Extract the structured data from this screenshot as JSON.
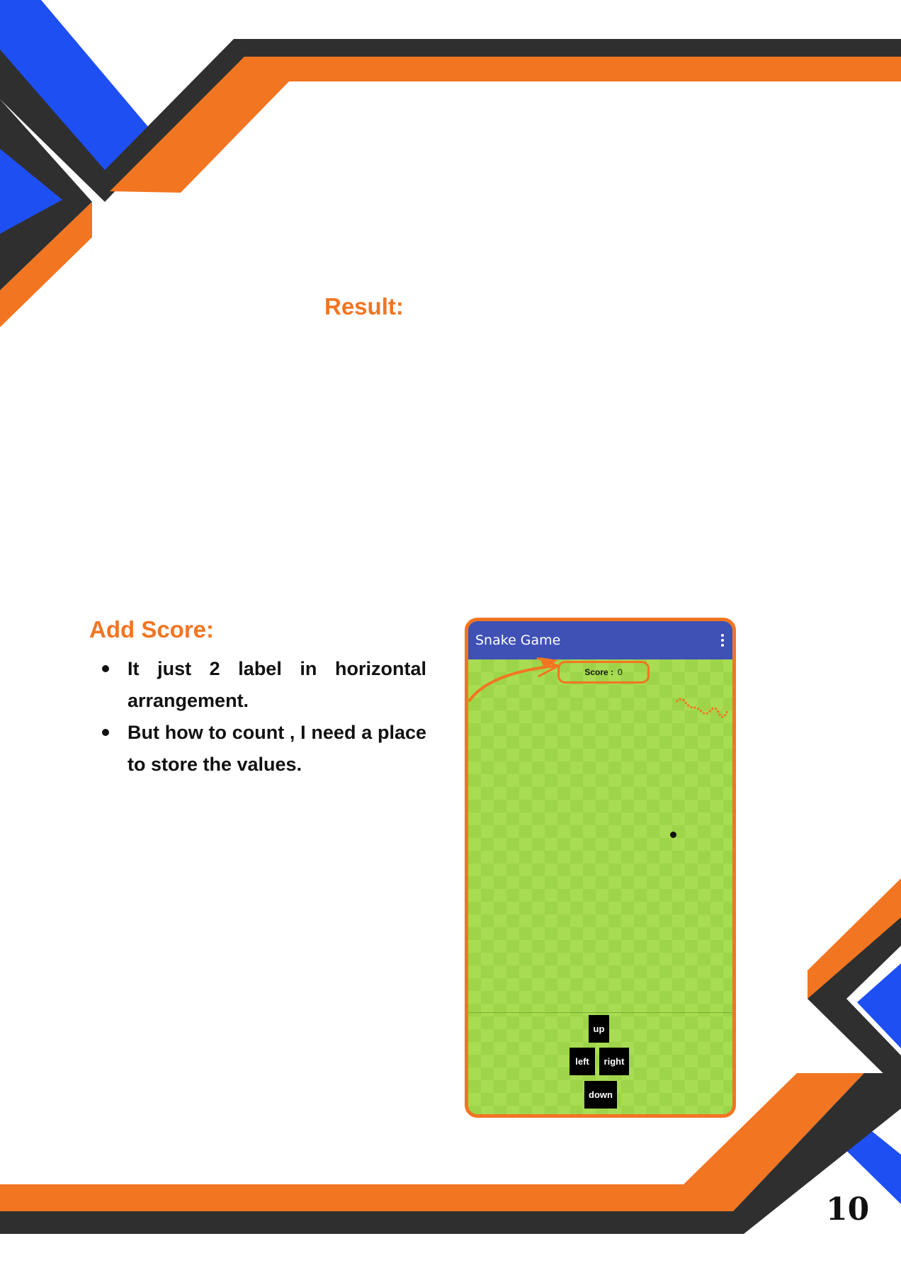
{
  "result_heading": "Result:",
  "add_score_heading": "Add Score:",
  "bullets": [
    "It just 2 label in horizontal arrangement.",
    "But how to count , I need a place to store the values."
  ],
  "page_number": "10",
  "phone": {
    "app_title": "Snake Game",
    "menu_icon": "more-vert-icon",
    "score_label": "Score :",
    "score_value": "0",
    "controls": {
      "up": "up",
      "left": "left",
      "right": "right",
      "down": "down"
    }
  },
  "colors": {
    "orange": "#f27522",
    "blue": "#1e4ff3",
    "dark": "#2f2f2f",
    "app_bar": "#3f51b5",
    "grass": "#9ed44a"
  }
}
